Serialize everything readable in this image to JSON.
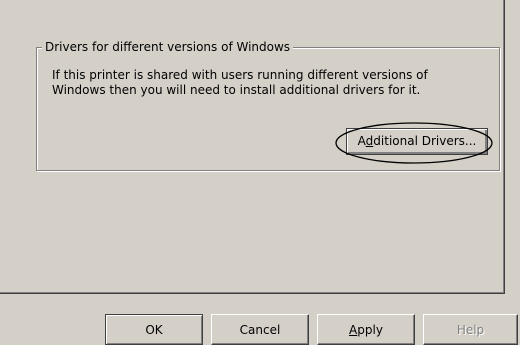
{
  "group": {
    "title": "Drivers for different versions of Windows",
    "description": "If this printer is shared with users running different versions of\nWindows then you will need to install additional drivers for it.",
    "additional_drivers": {
      "before": "A",
      "mnemonic": "d",
      "after": "ditional Drivers..."
    }
  },
  "buttons": {
    "ok": "OK",
    "cancel": "Cancel",
    "apply": {
      "mnemonic": "A",
      "after": "pply"
    },
    "help": "Help"
  },
  "annotation": {
    "highlight_color": "#000000"
  }
}
